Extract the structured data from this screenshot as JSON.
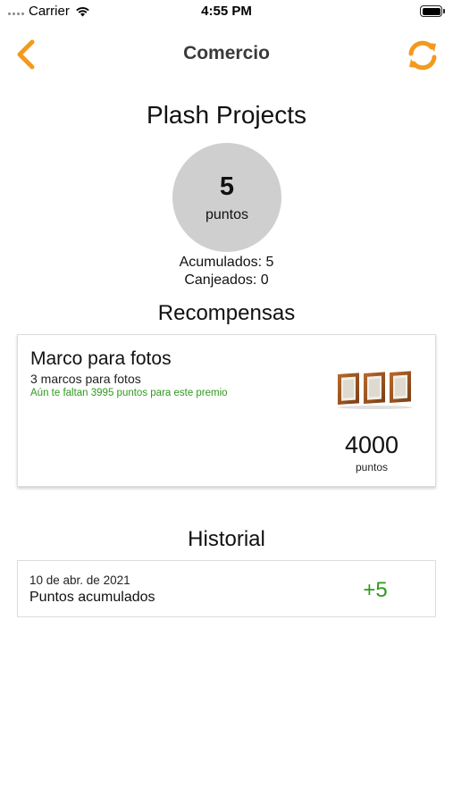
{
  "status_bar": {
    "carrier": "Carrier",
    "time": "4:55 PM"
  },
  "nav": {
    "title": "Comercio",
    "back_icon": "chevron-left-icon",
    "refresh_icon": "refresh-icon",
    "accent_color": "#F39A1E"
  },
  "business": {
    "name": "Plash Projects",
    "points": "5",
    "points_unit": "puntos",
    "accumulated": "Acumulados: 5",
    "redeemed": "Canjeados: 0"
  },
  "rewards": {
    "section_title": "Recompensas",
    "items": [
      {
        "title": "Marco para fotos",
        "description": "3 marcos para fotos",
        "note": "Aún te faltan 3995 puntos para este premio",
        "cost": "4000",
        "cost_unit": "puntos",
        "image_icon": "photo-frames-image"
      }
    ]
  },
  "history": {
    "section_title": "Historial",
    "items": [
      {
        "date": "10 de abr. de 2021",
        "description": "Puntos acumulados",
        "points": "+5"
      }
    ]
  },
  "colors": {
    "accent": "#F39A1E",
    "positive": "#2F9A1E",
    "circle": "#CFCFCF"
  }
}
